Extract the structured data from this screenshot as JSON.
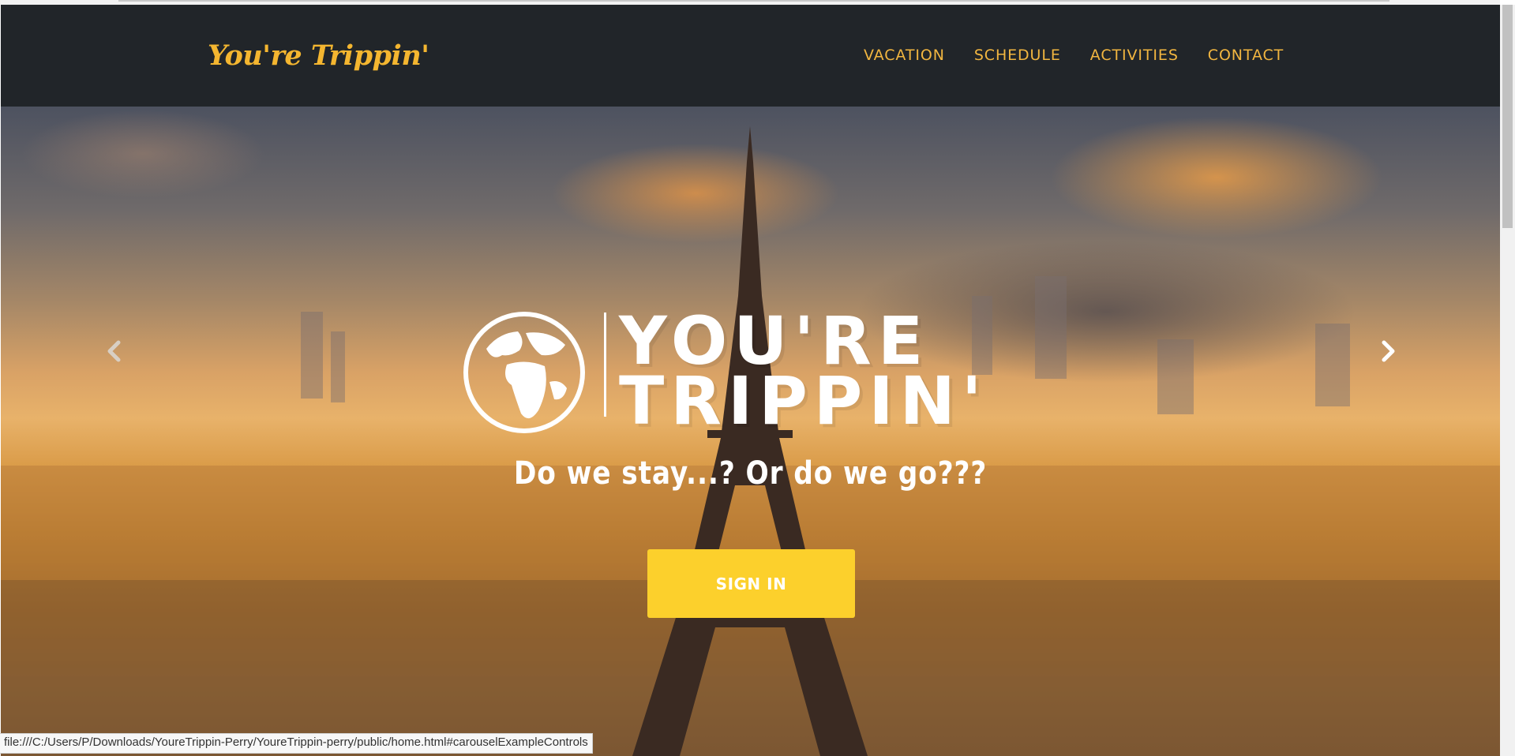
{
  "brand": {
    "name": "You're Trippin'",
    "color": "#f4b630"
  },
  "nav": {
    "items": [
      "VACATION",
      "SCHEDULE",
      "ACTIVITIES",
      "CONTACT"
    ]
  },
  "hero": {
    "logo_line1": "YOU'RE",
    "logo_line2": "TRIPPIN'",
    "tagline": "Do we stay...? Or do we go???",
    "cta_label": "SIGN IN",
    "cta_color": "#fcd02c",
    "prev_icon": "chevron-left-icon",
    "next_icon": "chevron-right-icon"
  },
  "status_url": "file:///C:/Users/P/Downloads/YoureTrippin-Perry/YoureTrippin-perry/public/home.html#carouselExampleControls"
}
